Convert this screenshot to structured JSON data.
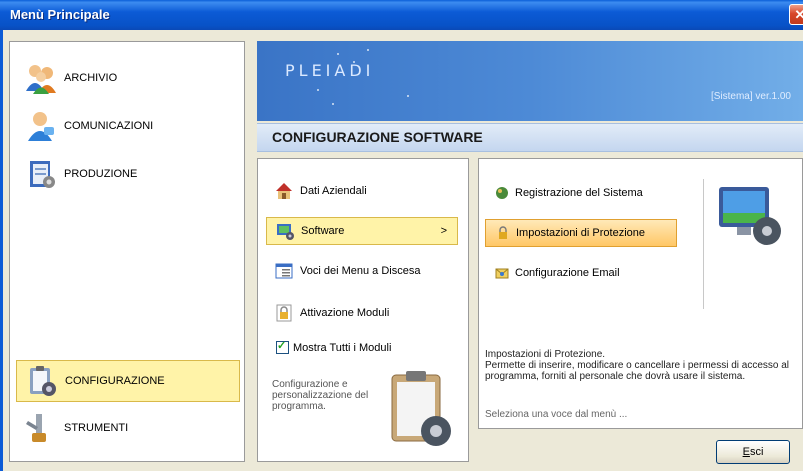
{
  "window": {
    "title": "Menù Principale",
    "close_glyph": "✕"
  },
  "nav": {
    "items": [
      {
        "label": "ARCHIVIO",
        "icon": "users-icon"
      },
      {
        "label": "COMUNICAZIONI",
        "icon": "contact-icon"
      },
      {
        "label": "PRODUZIONE",
        "icon": "notebook-icon"
      },
      {
        "label": "CONFIGURAZIONE",
        "icon": "clipboard-gear-icon",
        "selected": true
      },
      {
        "label": "STRUMENTI",
        "icon": "tools-icon"
      }
    ]
  },
  "header": {
    "logo": "PLEIADI",
    "version": "[Sistema]  ver.1.00"
  },
  "section": {
    "title": "CONFIGURAZIONE SOFTWARE"
  },
  "menu": {
    "items": [
      {
        "label": "Dati Aziendali",
        "icon": "house-icon"
      },
      {
        "label": "Software",
        "icon": "monitor-gear-icon",
        "selected": true,
        "chevron": ">"
      },
      {
        "label": "Voci dei Menu a Discesa",
        "icon": "window-list-icon"
      },
      {
        "label": "Attivazione Moduli",
        "icon": "lock-icon"
      }
    ],
    "show_all_label": "Mostra Tutti i Moduli",
    "show_all_checked": true,
    "description": "Configurazione e personalizzazione del programma."
  },
  "submenu": {
    "items": [
      {
        "label": "Registrazione del Sistema",
        "icon": "register-icon"
      },
      {
        "label": "Impostazioni di Protezione",
        "icon": "padlock-icon",
        "selected": true
      },
      {
        "label": "Configurazione Email",
        "icon": "email-icon"
      }
    ],
    "description_title": "Impostazioni di Protezione.",
    "description_body": "Permette di inserire, modificare o cancellare i permessi di accesso al programma, forniti al personale che dovrà usare il sistema.",
    "hint": "Seleziona una voce dal menù ..."
  },
  "footer": {
    "exit_label_first": "E",
    "exit_label_rest": "sci"
  },
  "colors": {
    "titlebar": "#0c5bd6",
    "selection": "#fff3a8",
    "header": "#4d8ad6",
    "orange_selection": "#ffc766"
  }
}
